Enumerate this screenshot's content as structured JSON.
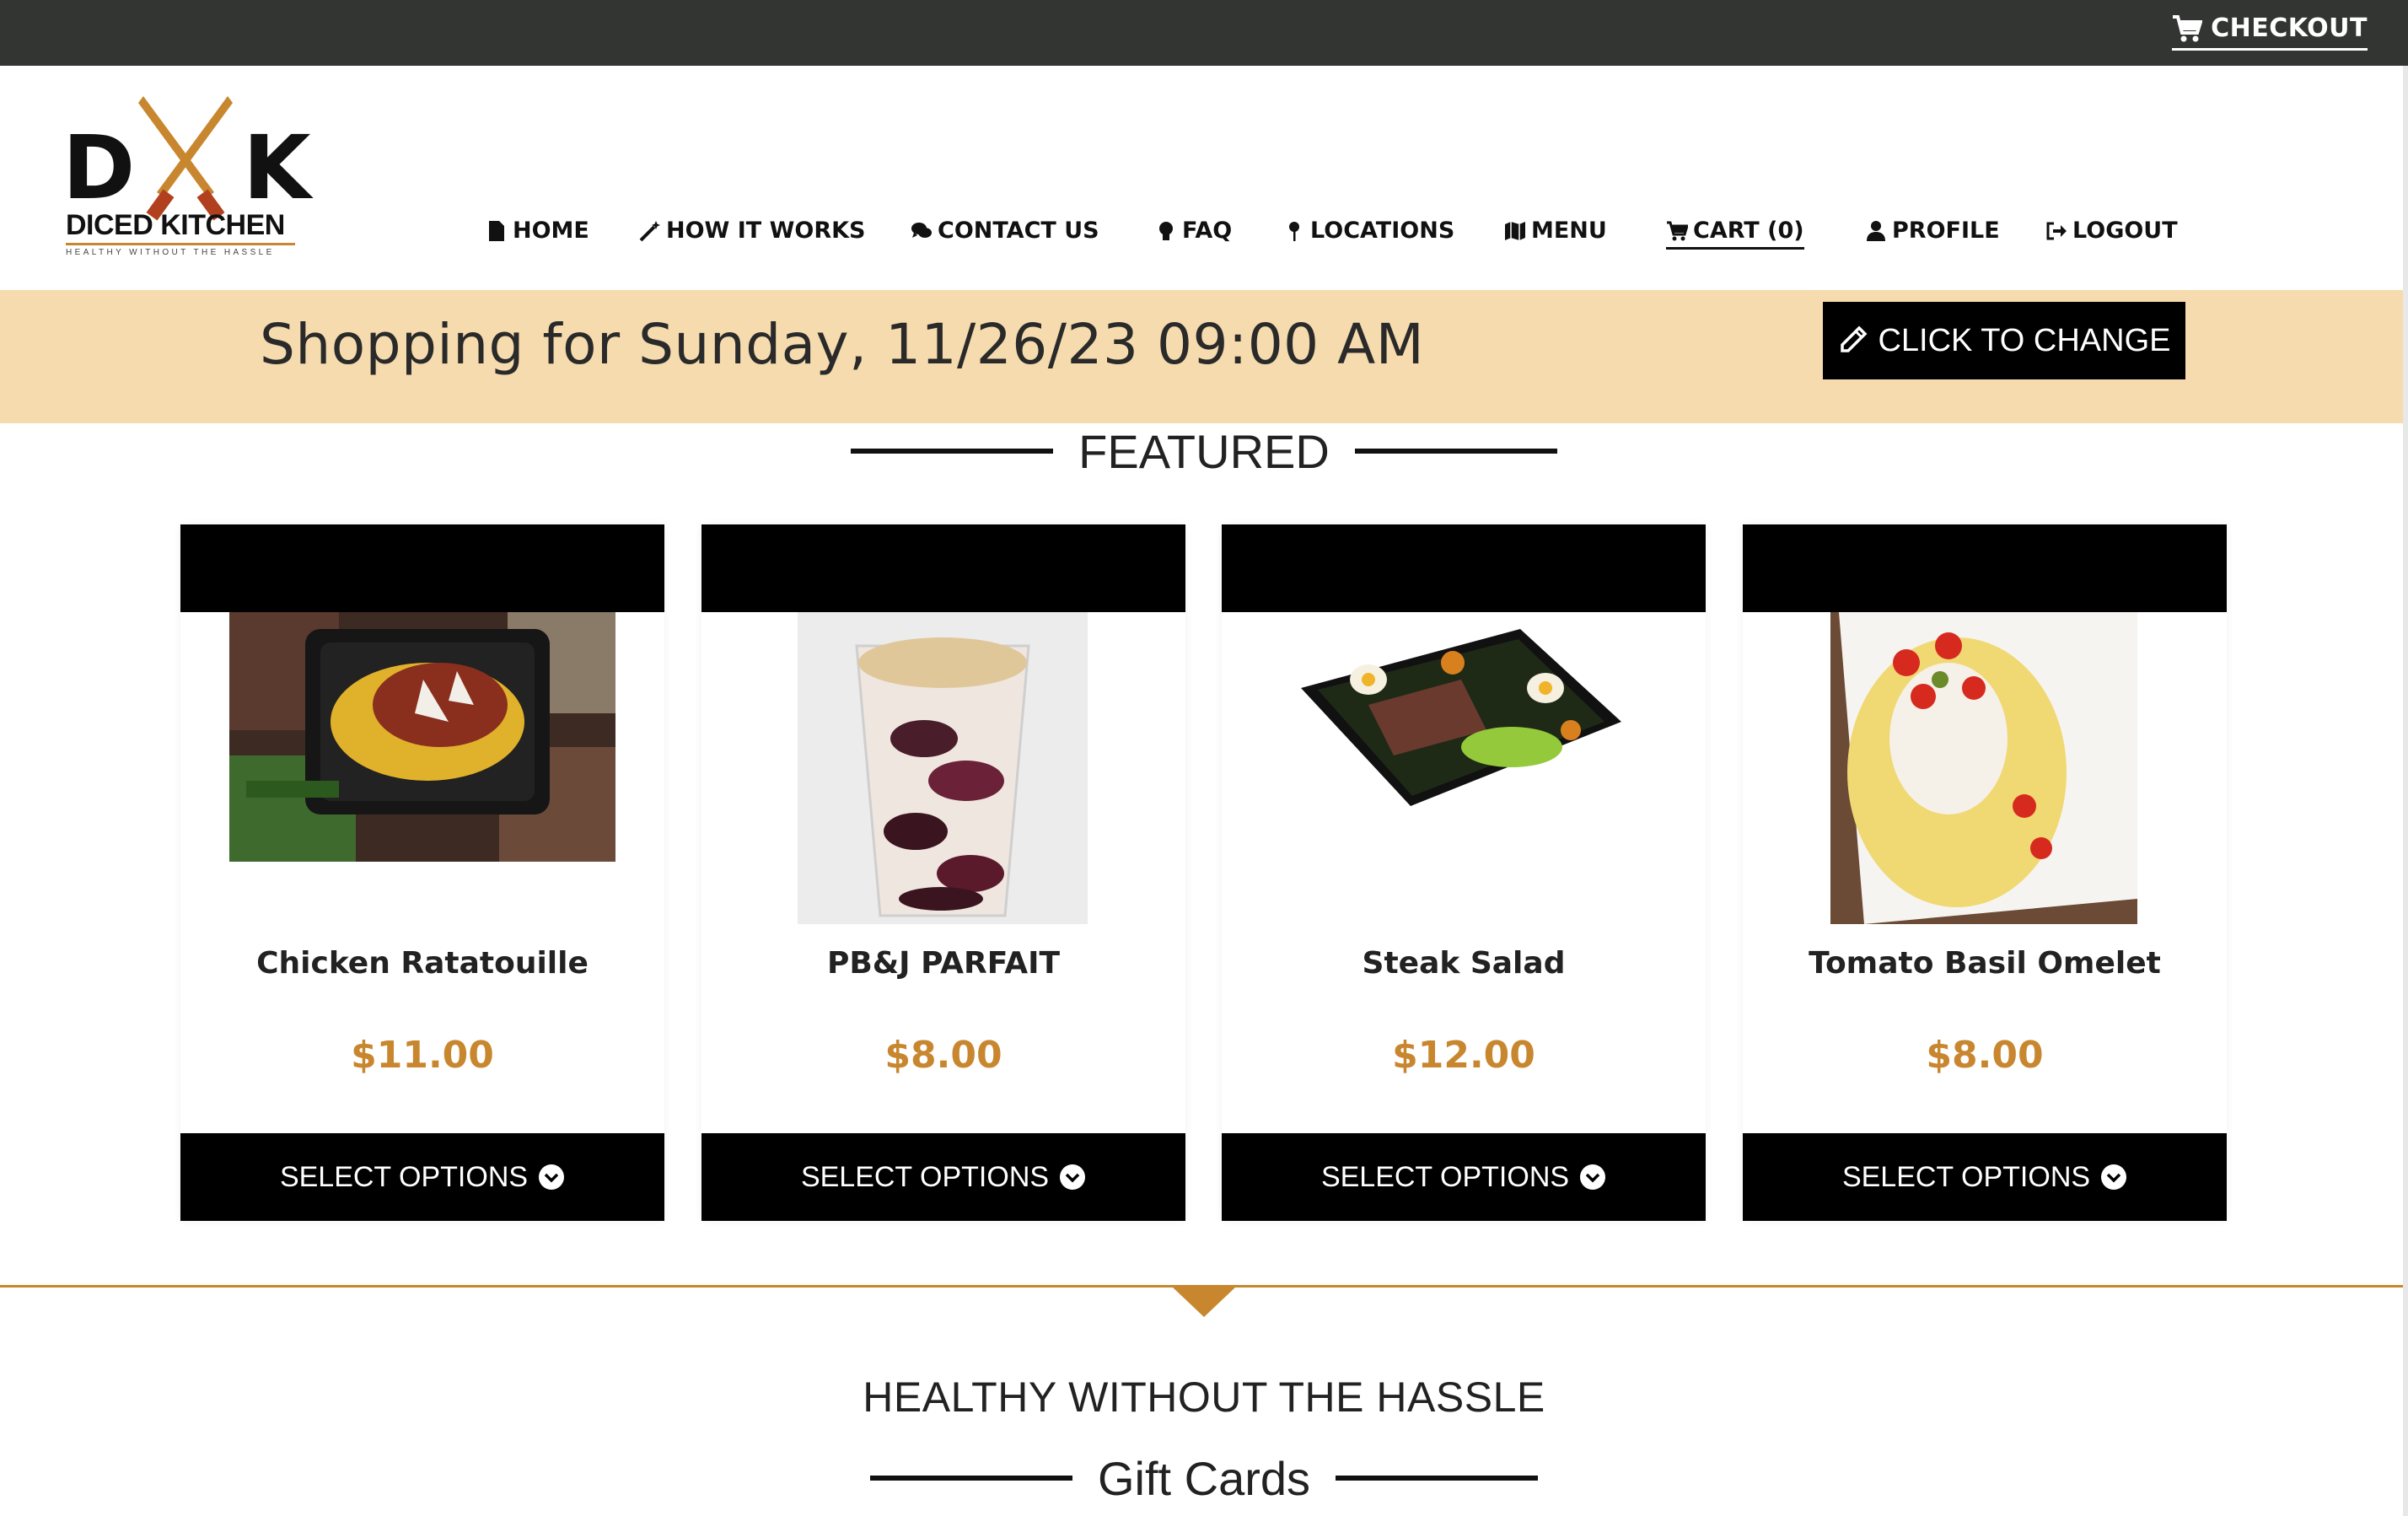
{
  "topbar": {
    "checkout_label": "CHECKOUT",
    "checkout_icon": "cart-icon"
  },
  "logo": {
    "letter_left": "D",
    "letter_right": "K",
    "name": "DICED KITCHEN",
    "tagline": "HEALTHY WITHOUT THE HASSLE",
    "accent_color": "#c8872f"
  },
  "nav": {
    "items": [
      {
        "label": "HOME",
        "icon": "file-icon"
      },
      {
        "label": "HOW IT WORKS",
        "icon": "magic-wand-icon"
      },
      {
        "label": "CONTACT US",
        "icon": "chat-bubbles-icon"
      },
      {
        "label": "FAQ",
        "icon": "lightbulb-icon"
      },
      {
        "label": "LOCATIONS",
        "icon": "map-pin-icon"
      },
      {
        "label": "MENU",
        "icon": "map-icon"
      },
      {
        "label": "CART (0)",
        "icon": "cart-icon"
      },
      {
        "label": "PROFILE",
        "icon": "user-icon"
      },
      {
        "label": "LOGOUT",
        "icon": "sign-out-icon"
      }
    ]
  },
  "banner": {
    "text": "Shopping for Sunday, 11/26/23 09:00 AM",
    "change_label": "CLICK TO CHANGE",
    "change_icon": "pencil-icon",
    "bg_color": "#f5dbad"
  },
  "featured": {
    "title": "FEATURED",
    "products": [
      {
        "name": "Chicken Ratatouille",
        "price": "$11.00",
        "button": "SELECT OPTIONS",
        "image": "meal-prep-containers"
      },
      {
        "name": "PB&J PARFAIT",
        "price": "$8.00",
        "button": "SELECT OPTIONS",
        "image": "parfait-cup"
      },
      {
        "name": "Steak Salad",
        "price": "$12.00",
        "button": "SELECT OPTIONS",
        "image": "steak-salad-container"
      },
      {
        "name": "Tomato Basil Omelet",
        "price": "$8.00",
        "button": "SELECT OPTIONS",
        "image": "omelet-plate"
      }
    ],
    "price_color": "#c8872f"
  },
  "tagline": "HEALTHY WITHOUT THE HASSLE",
  "gift_cards": {
    "title": "Gift Cards"
  }
}
